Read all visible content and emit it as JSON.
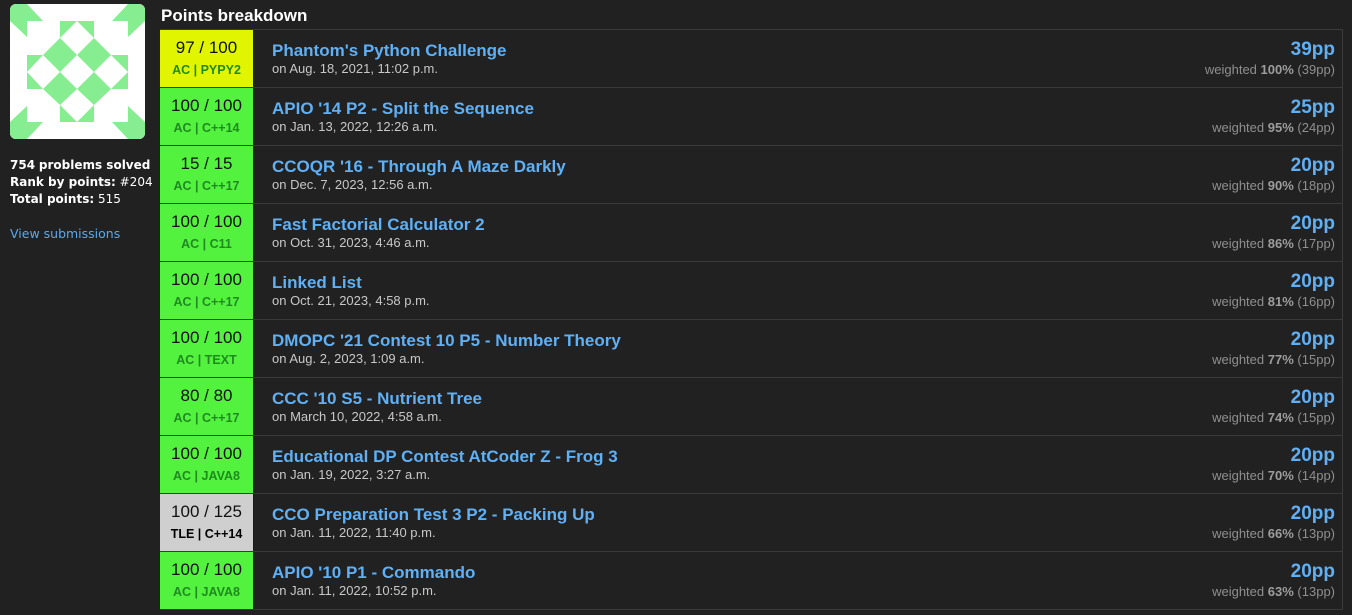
{
  "sidebar": {
    "avatar_colors": {
      "fg": "#86ee90",
      "bg": "#ffffff"
    },
    "problems_solved_count": "754",
    "problems_solved_label": "problems solved",
    "rank_label": "Rank by points:",
    "rank_value": "#204",
    "total_points_label": "Total points:",
    "total_points_value": "515",
    "view_submissions_label": "View submissions"
  },
  "main": {
    "section_title": "Points breakdown",
    "colors": {
      "ac_bg": "#53f23f",
      "ac_text": "#1f8a1f",
      "partial_bg": "#e1f500",
      "tle_bg": "#cfcfcf",
      "tle_text": "#000000",
      "link": "#5fb0f5"
    },
    "weighted_label": "weighted",
    "rows": [
      {
        "score": "97 / 100",
        "verdict": "AC | PYPY2",
        "state": "partial",
        "problem": "Phantom's Python Challenge",
        "date": "on Aug. 18, 2021, 11:02 p.m.",
        "points": "39pp",
        "weight": "100%",
        "weighted_points": "(39pp)"
      },
      {
        "score": "100 / 100",
        "verdict": "AC | C++14",
        "state": "ac",
        "problem": "APIO '14 P2 - Split the Sequence",
        "date": "on Jan. 13, 2022, 12:26 a.m.",
        "points": "25pp",
        "weight": "95%",
        "weighted_points": "(24pp)"
      },
      {
        "score": "15 / 15",
        "verdict": "AC | C++17",
        "state": "ac",
        "problem": "CCOQR '16 - Through A Maze Darkly",
        "date": "on Dec. 7, 2023, 12:56 a.m.",
        "points": "20pp",
        "weight": "90%",
        "weighted_points": "(18pp)"
      },
      {
        "score": "100 / 100",
        "verdict": "AC | C11",
        "state": "ac",
        "problem": "Fast Factorial Calculator 2",
        "date": "on Oct. 31, 2023, 4:46 a.m.",
        "points": "20pp",
        "weight": "86%",
        "weighted_points": "(17pp)"
      },
      {
        "score": "100 / 100",
        "verdict": "AC | C++17",
        "state": "ac",
        "problem": "Linked List",
        "date": "on Oct. 21, 2023, 4:58 p.m.",
        "points": "20pp",
        "weight": "81%",
        "weighted_points": "(16pp)"
      },
      {
        "score": "100 / 100",
        "verdict": "AC | TEXT",
        "state": "ac",
        "problem": "DMOPC '21 Contest 10 P5 - Number Theory",
        "date": "on Aug. 2, 2023, 1:09 a.m.",
        "points": "20pp",
        "weight": "77%",
        "weighted_points": "(15pp)"
      },
      {
        "score": "80 / 80",
        "verdict": "AC | C++17",
        "state": "ac",
        "problem": "CCC '10 S5 - Nutrient Tree",
        "date": "on March 10, 2022, 4:58 a.m.",
        "points": "20pp",
        "weight": "74%",
        "weighted_points": "(15pp)"
      },
      {
        "score": "100 / 100",
        "verdict": "AC | JAVA8",
        "state": "ac",
        "problem": "Educational DP Contest AtCoder Z - Frog 3",
        "date": "on Jan. 19, 2022, 3:27 a.m.",
        "points": "20pp",
        "weight": "70%",
        "weighted_points": "(14pp)"
      },
      {
        "score": "100 / 125",
        "verdict": "TLE | C++14",
        "state": "tle",
        "problem": "CCO Preparation Test 3 P2 - Packing Up",
        "date": "on Jan. 11, 2022, 11:40 p.m.",
        "points": "20pp",
        "weight": "66%",
        "weighted_points": "(13pp)"
      },
      {
        "score": "100 / 100",
        "verdict": "AC | JAVA8",
        "state": "ac",
        "problem": "APIO '10 P1 - Commando",
        "date": "on Jan. 11, 2022, 10:52 p.m.",
        "points": "20pp",
        "weight": "63%",
        "weighted_points": "(13pp)"
      }
    ]
  }
}
